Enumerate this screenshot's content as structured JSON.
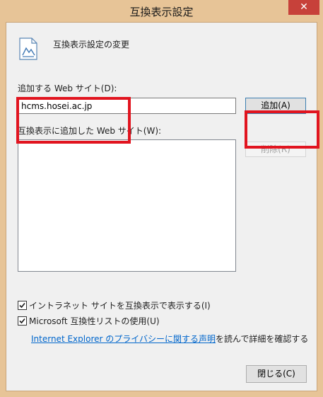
{
  "window": {
    "title": "互換表示設定",
    "close_glyph": "✕"
  },
  "header": {
    "icon": "document-image-icon",
    "text": "互換表示設定の変更"
  },
  "add_site": {
    "label": "追加する Web サイト(D):",
    "input_value": "hcms.hosei.ac.jp",
    "add_button_label": "追加(A)"
  },
  "site_list": {
    "label": "互換表示に追加した Web サイト(W):",
    "items": [],
    "remove_button_label": "削除(R)"
  },
  "options": [
    {
      "label": "イントラネット サイトを互換表示で表示する(I)",
      "checked": true
    },
    {
      "label": "Microsoft 互換性リストの使用(U)",
      "checked": true
    }
  ],
  "privacy": {
    "link_text": "Internet Explorer のプライバシーに関する声明",
    "suffix_text": "を読んで詳細を確認する"
  },
  "footer": {
    "close_button_label": "閉じる(C)"
  },
  "colors": {
    "title_bar": "#e7c497",
    "close_button": "#c7413a",
    "highlight": "#e1141f",
    "link": "#0066cc"
  }
}
